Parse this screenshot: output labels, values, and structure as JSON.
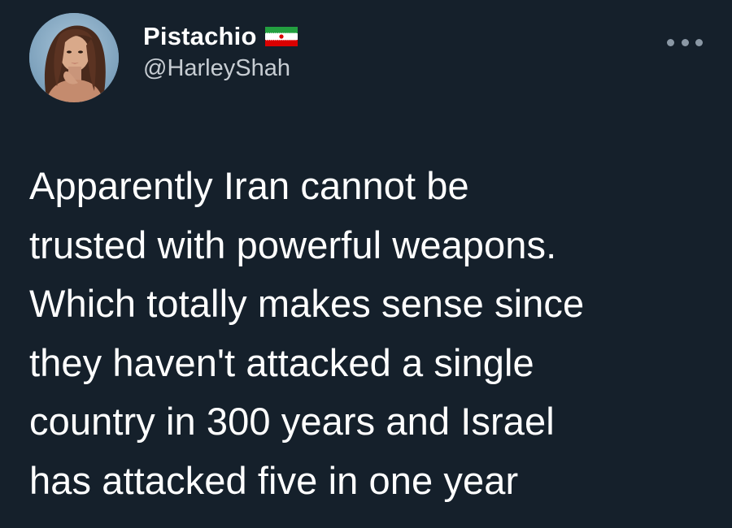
{
  "tweet": {
    "display_name": "Pistachio",
    "handle": "@HarleyShah",
    "flag_icon": "iran-flag-icon",
    "more_icon": "more-options-icon",
    "text_lines": [
      "Apparently Iran cannot be",
      "trusted with powerful weapons.",
      "Which totally makes sense since",
      "they haven't attacked a single",
      "country in 300 years and Israel",
      "has attacked five in one year"
    ]
  },
  "colors": {
    "background": "#15202b",
    "text": "#ffffff",
    "secondary_text": "#c7cdd3",
    "icon": "#8b98a5"
  }
}
